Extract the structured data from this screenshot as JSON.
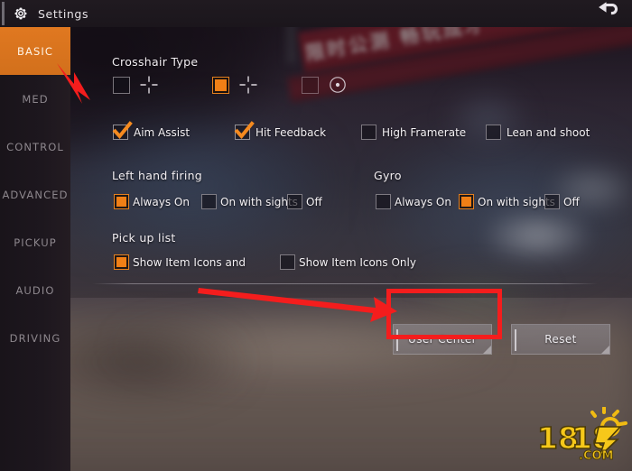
{
  "header": {
    "title": "Settings",
    "gear_icon": "gear-icon",
    "back_icon": "back-arrow-icon"
  },
  "sidebar": {
    "items": [
      {
        "label": "BASIC",
        "active": true
      },
      {
        "label": "MED",
        "active": false
      },
      {
        "label": "CONTROL",
        "active": false
      },
      {
        "label": "ADVANCED",
        "active": false
      },
      {
        "label": "PICKUP",
        "active": false
      },
      {
        "label": "AUDIO",
        "active": false
      },
      {
        "label": "DRIVING",
        "active": false
      }
    ]
  },
  "main": {
    "crosshair": {
      "label": "Crosshair Type",
      "options": [
        {
          "icon": "crosshair-plus-icon",
          "selected": false
        },
        {
          "icon": "crosshair-plus-icon",
          "selected": true
        },
        {
          "icon": "crosshair-dot-circle-icon",
          "selected": false
        }
      ]
    },
    "toggles": [
      {
        "label": "Aim Assist",
        "checked": true
      },
      {
        "label": "Hit Feedback",
        "checked": true
      },
      {
        "label": "High Framerate",
        "checked": false
      },
      {
        "label": "Lean and shoot",
        "checked": false
      }
    ],
    "left_hand_firing": {
      "label": "Left hand firing",
      "options": [
        {
          "label": "Always On",
          "selected": true
        },
        {
          "label": "On with sights",
          "selected": false
        },
        {
          "label": "Off",
          "selected": false
        }
      ]
    },
    "gyro": {
      "label": "Gyro",
      "options": [
        {
          "label": "Always On",
          "selected": false
        },
        {
          "label": "On with sights",
          "selected": true
        },
        {
          "label": "Off",
          "selected": false
        }
      ]
    },
    "pickup_list": {
      "label": "Pick up list",
      "options": [
        {
          "label": "Show Item Icons and",
          "selected": true
        },
        {
          "label": "Show Item Icons Only",
          "selected": false
        }
      ]
    },
    "buttons": {
      "user_center": "User Center",
      "reset": "Reset"
    }
  },
  "background": {
    "banner_text": "限时公测 畅玩成才"
  },
  "watermark": {
    "text": "18183",
    "suffix": ".COM"
  },
  "colors": {
    "accent_orange": "#e07820",
    "checkbox_orange": "#f07f16",
    "annotation_red": "#f41d1d",
    "sidebar_bg": "#19141a",
    "header_bg": "#201a20",
    "watermark_gold": "#f5c518"
  }
}
